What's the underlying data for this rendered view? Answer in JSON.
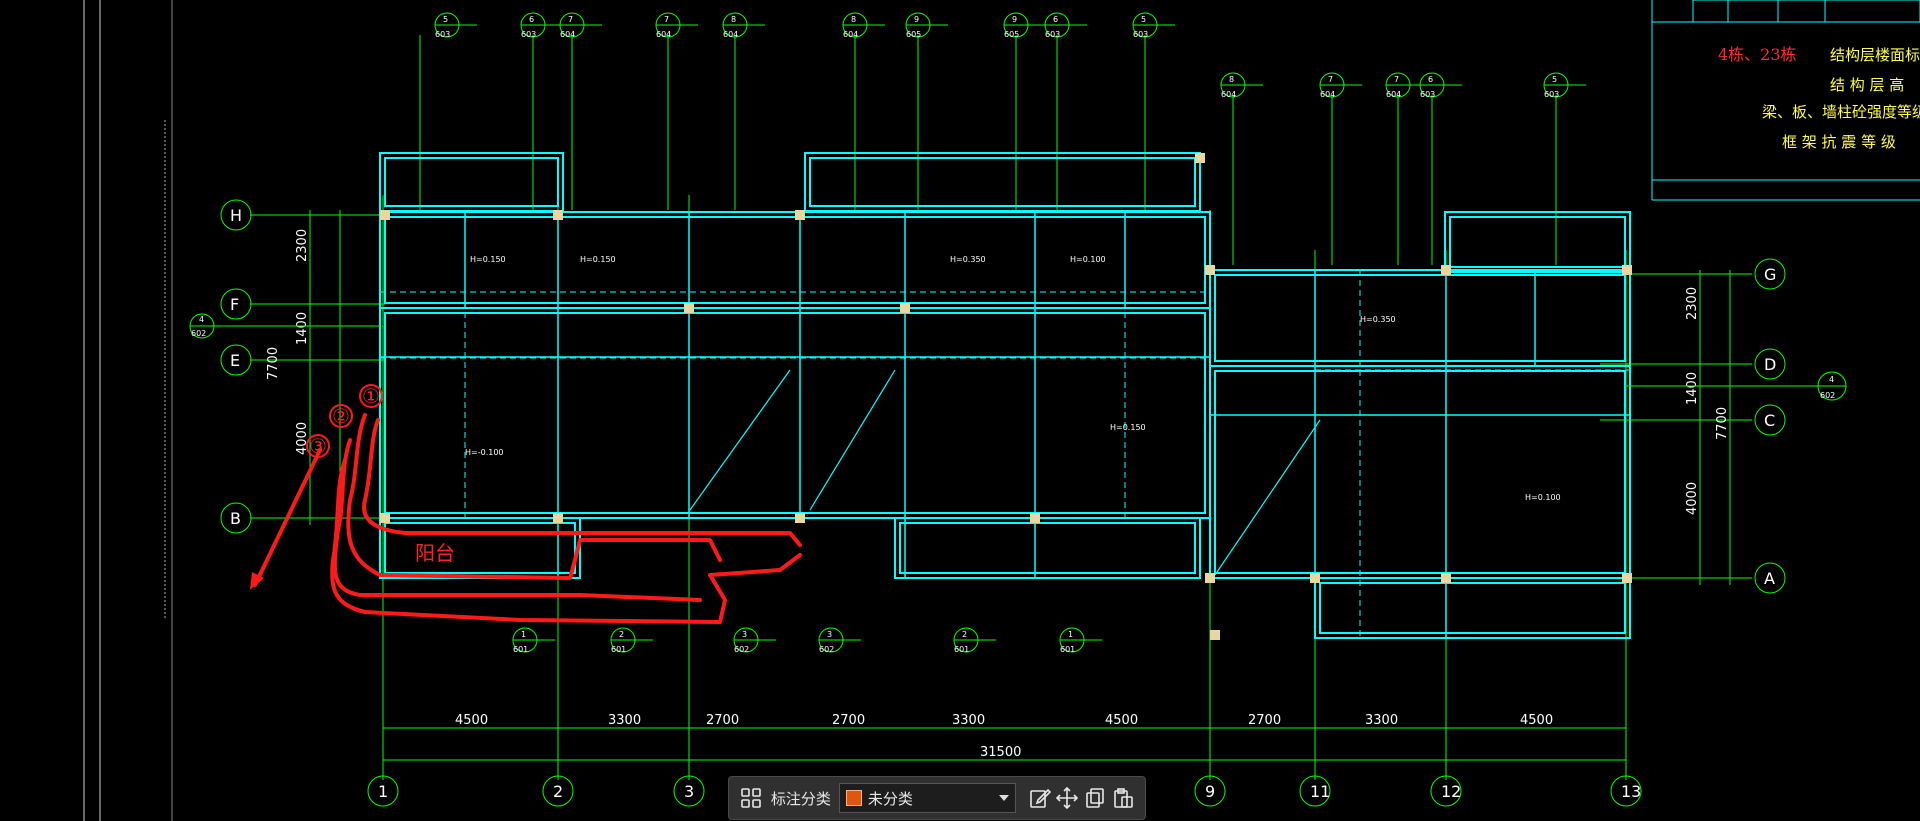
{
  "grid_top": [
    {
      "num": "5",
      "code": "603"
    },
    {
      "num": "6",
      "code": "603"
    },
    {
      "num": "7",
      "code": "604"
    },
    {
      "num": "7",
      "code": "604"
    },
    {
      "num": "8",
      "code": "604"
    },
    {
      "num": "8",
      "code": "604"
    },
    {
      "num": "9",
      "code": "605"
    },
    {
      "num": "9",
      "code": "605"
    },
    {
      "num": "6",
      "code": "603"
    },
    {
      "num": "5",
      "code": "603"
    }
  ],
  "grid_top_right": [
    {
      "num": "8",
      "code": "604"
    },
    {
      "num": "7",
      "code": "604"
    },
    {
      "num": "7",
      "code": "604"
    },
    {
      "num": "6",
      "code": "603"
    },
    {
      "num": "5",
      "code": "603"
    }
  ],
  "grid_bottom_labels": [
    {
      "num": "1",
      "code": "601"
    },
    {
      "num": "2",
      "code": "601"
    },
    {
      "num": "3",
      "code": "602"
    },
    {
      "num": "3",
      "code": "602"
    },
    {
      "num": "2",
      "code": "601"
    },
    {
      "num": "1",
      "code": "601"
    }
  ],
  "row_axes_left": [
    "H",
    "F",
    "E",
    "B"
  ],
  "row_axes_right": [
    "G",
    "D",
    "C",
    "A"
  ],
  "column_axes": [
    "1",
    "2",
    "3",
    "9",
    "11",
    "12",
    "13"
  ],
  "left_dims": [
    "2300",
    "1400",
    "4000",
    "7700"
  ],
  "right_dims": [
    "2300",
    "1400",
    "4000",
    "7700"
  ],
  "bottom_dims": [
    "4500",
    "3300",
    "2700",
    "2700",
    "3300",
    "4500",
    "2700",
    "3300",
    "4500"
  ],
  "total_dim": "31500",
  "side_markers": {
    "left_num": "4",
    "left_code": "602",
    "right_num": "4",
    "right_code": "602"
  },
  "annotations": {
    "balcony": "阳台",
    "circle1": "①",
    "circle2": "②",
    "circle3": "③"
  },
  "title_block": {
    "building": "4栋、23栋",
    "line1": "结构层楼面标高",
    "line2": "结 构 层 高",
    "line3": "梁、板、墙柱砼强度等级",
    "line4": "框 架 抗 震 等 级"
  },
  "room_labels": [
    "H=0.150",
    "H=-0.100",
    "H=0.350",
    "H=0.100"
  ],
  "toolbar": {
    "label": "标注分类",
    "select_value": "未分类"
  },
  "colors": {
    "background": "#000000",
    "grid_line": "#00ff00",
    "wall": "#00ffff",
    "red_markup": "#ff1a1a",
    "accent_orange": "#e2560b"
  }
}
